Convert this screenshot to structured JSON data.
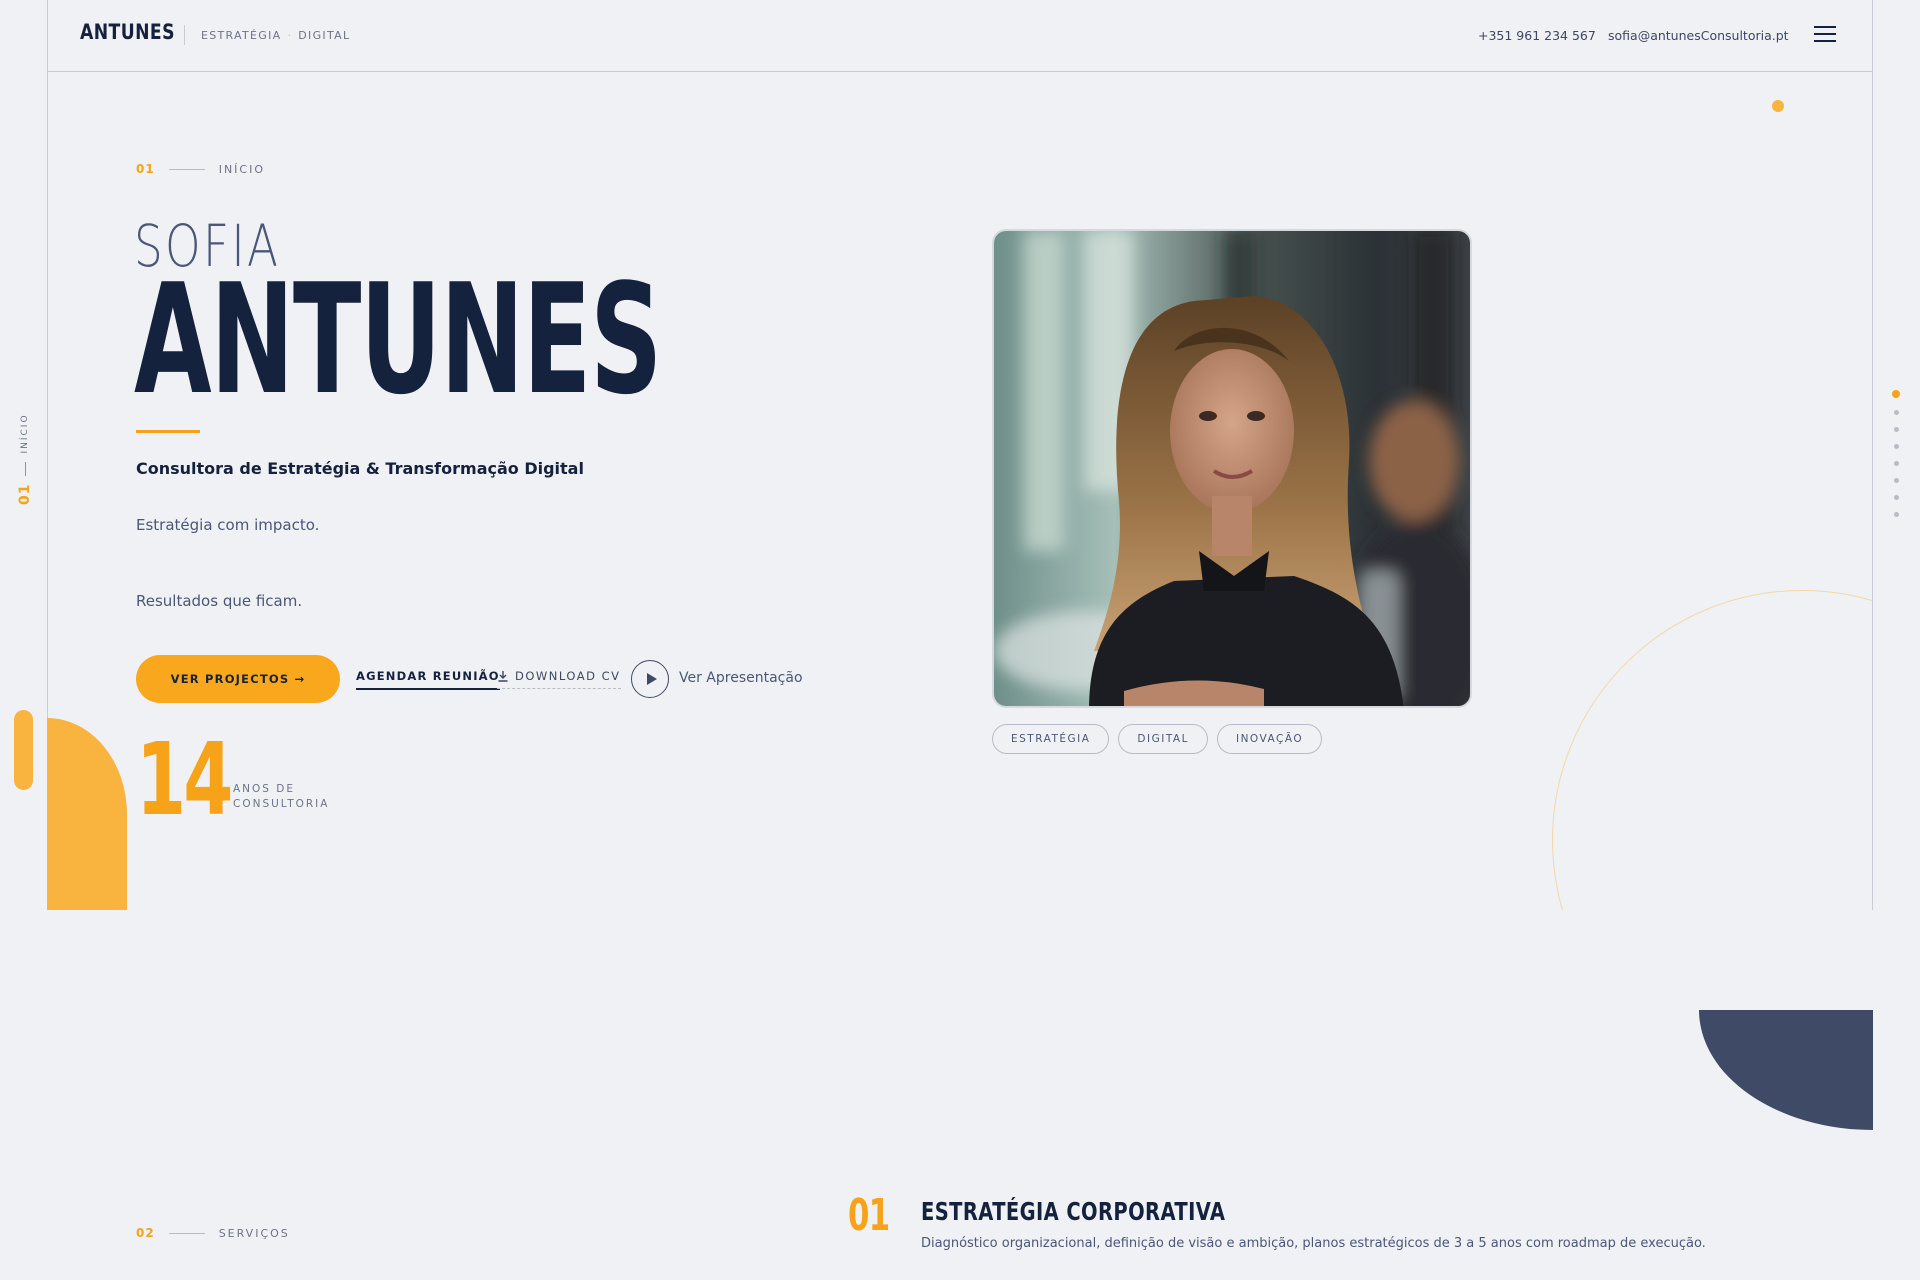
{
  "header": {
    "logo": "ANTUNES",
    "tagline": [
      "ESTRATÉGIA",
      "DIGITAL"
    ],
    "tagline_sep": "·",
    "phone": "+351 961 234 567",
    "email": "sofia@antunesConsultoria.pt",
    "menu_icon": "hamburger-icon"
  },
  "side_rail": {
    "number": "01",
    "label": "INÍCIO"
  },
  "hero": {
    "section_number": "01",
    "section_label": "INÍCIO",
    "first_name": "SOFIA",
    "last_name": "ANTUNES",
    "subtitle": "Consultora de Estratégia & Transformação Digital",
    "line1": "Estratégia com impacto.",
    "line2": "Resultados que ficam.",
    "buttons": {
      "primary": "VER PROJECTOS →",
      "meeting": "AGENDAR REUNIÃO",
      "cv": "DOWNLOAD CV",
      "presentation": "Ver Apresentação"
    },
    "stat": {
      "value": "14",
      "label": "ANOS DE CONSULTORIA"
    },
    "tags": [
      "ESTRATÉGIA",
      "DIGITAL",
      "INOVAÇÃO"
    ]
  },
  "dots_nav": {
    "count": 8,
    "active_index": 0
  },
  "services": {
    "section_number": "02",
    "section_label": "SERVIÇOS",
    "items": [
      {
        "number": "01",
        "title": "ESTRATÉGIA CORPORATIVA",
        "description": "Diagnóstico organizacional, definição de visão e ambição, planos estratégicos de 3 a 5 anos com roadmap de execução."
      }
    ]
  },
  "colors": {
    "accent": "#f6a31a",
    "navy": "#15223d",
    "slate": "#3f4a66",
    "background": "#f0f1f4"
  }
}
